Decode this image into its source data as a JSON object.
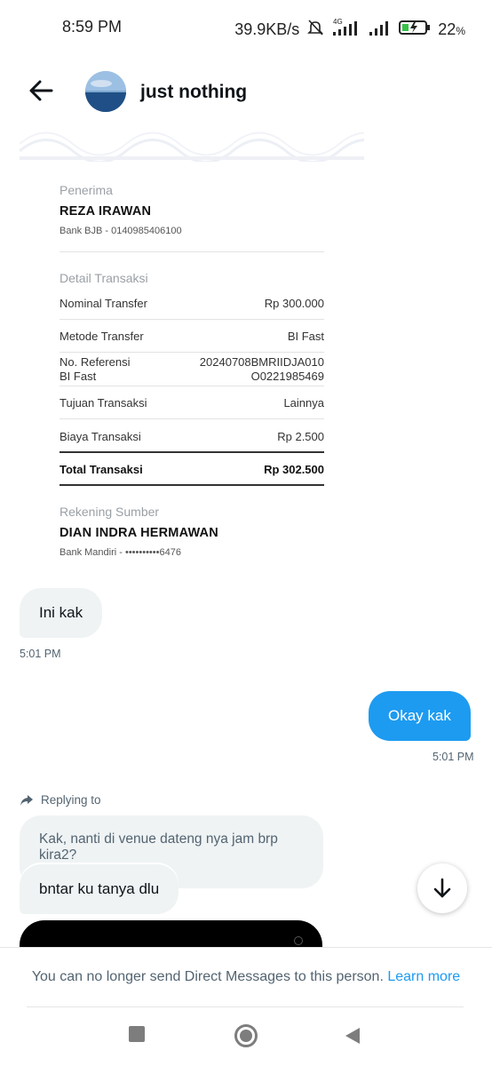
{
  "status_bar": {
    "time": "8:59 PM",
    "net_speed": "39.9KB/s",
    "network_type": "4G",
    "battery": "22",
    "battery_unit": "%"
  },
  "header": {
    "title": "just nothing"
  },
  "receipt": {
    "recipient_label": "Penerima",
    "recipient_name": "REZA IRAWAN",
    "recipient_bank": "Bank BJB - 0140985406100",
    "detail_label": "Detail Transaksi",
    "rows": [
      {
        "label": "Nominal Transfer",
        "value": "Rp 300.000"
      },
      {
        "label": "Metode Transfer",
        "value": "BI Fast"
      },
      {
        "label": "No. Referensi",
        "label2": "BI Fast",
        "value": "20240708BMRIIDJA010",
        "value2": "O0221985469"
      },
      {
        "label": "Tujuan Transaksi",
        "value": "Lainnya"
      },
      {
        "label": "Biaya Transaksi",
        "value": "Rp 2.500"
      }
    ],
    "total_label": "Total Transaksi",
    "total_value": "Rp 302.500",
    "source_label": "Rekening Sumber",
    "source_name": "DIAN INDRA HERMAWAN",
    "source_bank": "Bank Mandiri - ••••••••••6476"
  },
  "messages": {
    "m1_text": "Ini kak",
    "m1_time": "5:01 PM",
    "m2_text": "Okay kak",
    "m2_time": "5:01 PM",
    "reply_label": "Replying to",
    "quoted_text": "Kak, nanti di venue dateng nya jam brp kira2?",
    "m3_text": "bntar ku tanya dlu"
  },
  "footer": {
    "notice": "You can no longer send Direct Messages to this person.",
    "link": "Learn more"
  },
  "colors": {
    "accent": "#1d9bf0",
    "incoming_bubble": "#eff3f4",
    "secondary_text": "#536471"
  },
  "icons": [
    "back-arrow-icon",
    "mute-icon",
    "signal-icon",
    "battery-icon",
    "reply-arrow-icon",
    "arrow-down-icon",
    "recent-apps-icon",
    "home-icon",
    "nav-back-icon"
  ]
}
